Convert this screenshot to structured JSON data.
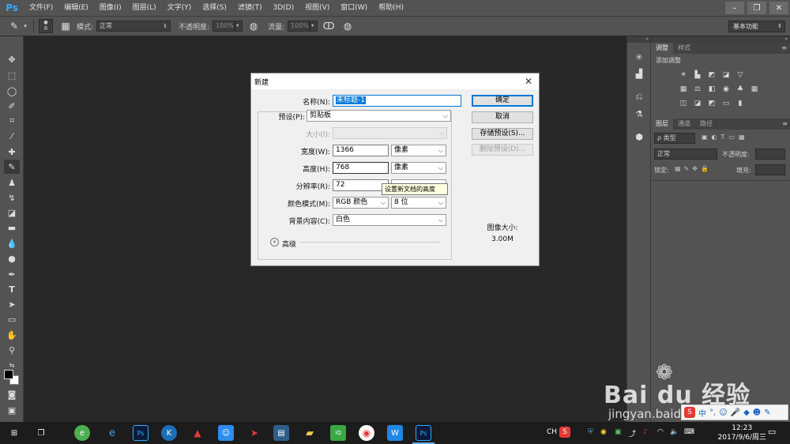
{
  "app": {
    "logo": "Ps",
    "menu": [
      "文件(F)",
      "编辑(E)",
      "图像(I)",
      "图层(L)",
      "文字(Y)",
      "选择(S)",
      "滤镜(T)",
      "3D(D)",
      "视图(V)",
      "窗口(W)",
      "帮助(H)"
    ]
  },
  "options": {
    "brush_size": "8",
    "mode_label": "模式:",
    "mode_value": "正常",
    "opacity_label": "不透明度:",
    "opacity_value": "100%",
    "flow_label": "流量:",
    "flow_value": "100%",
    "workspace": "基本功能"
  },
  "panels": {
    "top_tabs": [
      "调整",
      "样式"
    ],
    "add_adjustment": "添加调整",
    "layer_tabs": [
      "图层",
      "通道",
      "路径"
    ],
    "kind_filter": "ρ 类型",
    "blend_mode": "正常",
    "opacity_label": "不透明度:",
    "lock_label": "锁定:",
    "fill_label": "填充:"
  },
  "dialog": {
    "title": "新建",
    "name_label": "名称(N):",
    "name_value": "未标题-1",
    "preset_label": "预设(P):",
    "preset_value": "剪贴板",
    "size_label": "大小(I):",
    "width_label": "宽度(W):",
    "width_value": "1366",
    "width_unit": "像素",
    "height_label": "高度(H):",
    "height_value": "768",
    "height_unit": "像素",
    "resolution_label": "分辨率(R):",
    "resolution_value": "72",
    "color_mode_label": "颜色模式(M):",
    "color_mode_value": "RGB 颜色",
    "bit_depth_value": "8 位",
    "background_label": "背景内容(C):",
    "background_value": "白色",
    "advanced_label": "高级",
    "tooltip": "设置新文档的高度",
    "ok": "确定",
    "cancel": "取消",
    "save_preset": "存储预设(S)...",
    "delete_preset": "删除预设(D)...",
    "image_size_label": "图像大小:",
    "image_size_value": "3.00M"
  },
  "taskbar": {
    "tray_lang": "CH",
    "time": "12:23",
    "date": "2017/9/6/周三"
  },
  "watermark": {
    "line1": "Bai du 经验",
    "line2": "jingyan.baidu.com",
    "ime": "中"
  },
  "colors": {
    "accent": "#0078d7",
    "ps_blue": "#31a8ff",
    "ui_gray": "#535353",
    "canvas_bg": "#282828"
  }
}
